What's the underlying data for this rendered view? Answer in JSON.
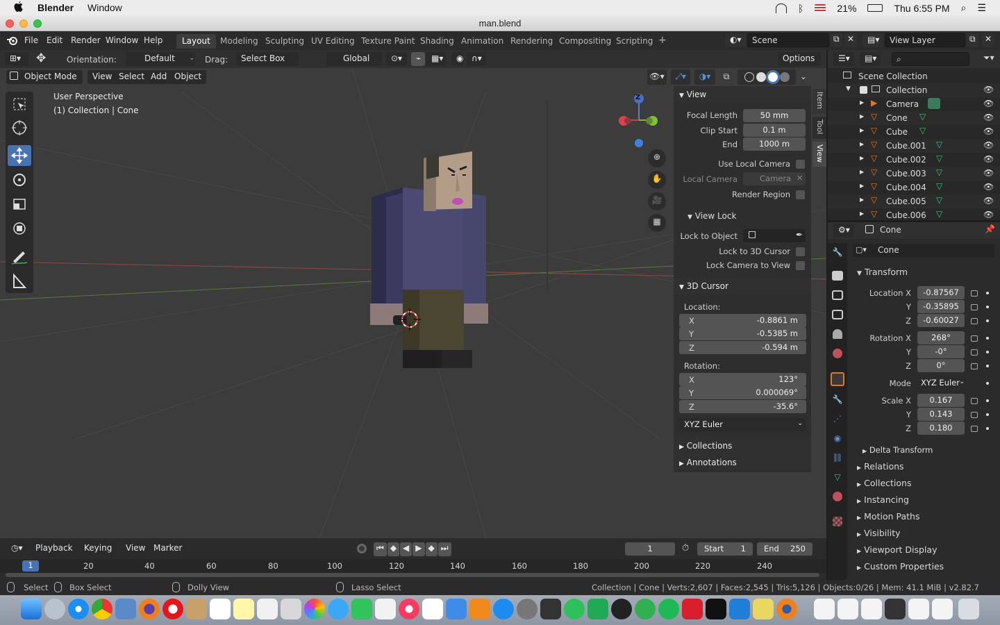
{
  "mac": {
    "app": "Blender",
    "menu_window": "Window",
    "battery": "21%",
    "clock": "Thu 6:55 PM"
  },
  "window": {
    "title": "man.blend"
  },
  "topbar": {
    "menus": [
      "File",
      "Edit",
      "Render",
      "Window",
      "Help"
    ],
    "workspaces": [
      "Layout",
      "Modeling",
      "Sculpting",
      "UV Editing",
      "Texture Paint",
      "Shading",
      "Animation",
      "Rendering",
      "Compositing",
      "Scripting"
    ],
    "active_workspace": "Layout",
    "scene": "Scene",
    "view_layer": "View Layer"
  },
  "tool_header": {
    "orientation_label": "Orientation:",
    "orientation_value": "Default",
    "drag_label": "Drag:",
    "drag_value": "Select Box",
    "transform_orientation": "Global",
    "options": "Options"
  },
  "viewport_header": {
    "mode": "Object Mode",
    "menus": [
      "View",
      "Select",
      "Add",
      "Object"
    ]
  },
  "viewport": {
    "perspective": "User Perspective",
    "collection_info": "(1) Collection | Cone",
    "gizmo_z": "Z"
  },
  "npanel": {
    "tabs": [
      "Item",
      "Tool",
      "View"
    ],
    "view": {
      "header": "View",
      "focal_length_label": "Focal Length",
      "focal_length": "50 mm",
      "clip_start_label": "Clip Start",
      "clip_start": "0.1 m",
      "end_label": "End",
      "end": "1000 m",
      "use_local_camera": "Use Local Camera",
      "local_camera_label": "Local Camera",
      "local_camera": "Camera",
      "render_region": "Render Region"
    },
    "view_lock": {
      "header": "View Lock",
      "lock_to_object": "Lock to Object",
      "lock_3d_cursor": "Lock to 3D Cursor",
      "lock_camera": "Lock Camera to View"
    },
    "cursor": {
      "header": "3D Cursor",
      "location_label": "Location:",
      "loc": [
        {
          "axis": "X",
          "value": "-0.8861 m"
        },
        {
          "axis": "Y",
          "value": "-0.5385 m"
        },
        {
          "axis": "Z",
          "value": "-0.594 m"
        }
      ],
      "rotation_label": "Rotation:",
      "rot": [
        {
          "axis": "X",
          "value": "123°"
        },
        {
          "axis": "Y",
          "value": "0.000069°"
        },
        {
          "axis": "Z",
          "value": "-35.6°"
        }
      ],
      "mode": "XYZ Euler"
    },
    "collections": "Collections",
    "annotations": "Annotations"
  },
  "timeline": {
    "menus": [
      "Playback",
      "Keying",
      "View",
      "Marker"
    ],
    "current_frame": "1",
    "start_label": "Start",
    "start": "1",
    "end_label": "End",
    "end": "250",
    "ticks": [
      "1",
      "20",
      "40",
      "60",
      "80",
      "100",
      "120",
      "140",
      "160",
      "180",
      "200",
      "220",
      "240"
    ]
  },
  "status": {
    "select": "Select",
    "box_select": "Box Select",
    "dolly_view": "Dolly View",
    "lasso_select": "Lasso Select",
    "info": "Collection | Cone | Verts:2,607 | Faces:2,545 | Tris:5,126 | Objects:0/26 | Mem: 41.1 MiB | v2.82.7"
  },
  "outliner": {
    "scene_collection": "Scene Collection",
    "collection": "Collection",
    "items": [
      "Camera",
      "Cone",
      "Cube",
      "Cube.001",
      "Cube.002",
      "Cube.003",
      "Cube.004",
      "Cube.005",
      "Cube.006"
    ]
  },
  "properties": {
    "context": "Cone",
    "object_name": "Cone",
    "transform": "Transform",
    "location_label": "Location X",
    "location": [
      "-0.87567",
      "-0.35895",
      "-0.60027"
    ],
    "rotation_label": "Rotation X",
    "rotation": [
      "268°",
      "-0°",
      "0°"
    ],
    "mode_label": "Mode",
    "mode": "XYZ Euler",
    "scale_label": "Scale X",
    "scale": [
      "0.167",
      "0.143",
      "0.180"
    ],
    "axis_y": "Y",
    "axis_z": "Z",
    "delta": "Delta Transform",
    "sections": [
      "Relations",
      "Collections",
      "Instancing",
      "Motion Paths",
      "Visibility",
      "Viewport Display",
      "Custom Properties"
    ]
  },
  "colors": {
    "accent": "#4772b3",
    "object_orange": "#e0782a",
    "mesh_green": "#3fc57a"
  }
}
